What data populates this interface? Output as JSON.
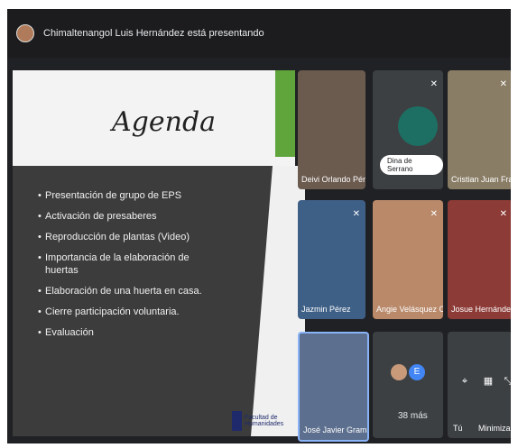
{
  "topbar": {
    "presenter_text": "Chimaltenangol Luis Hernández está presentando"
  },
  "slide": {
    "heading": "Agenda",
    "items": [
      "Presentación de grupo de EPS",
      "Activación de presaberes",
      "Reproducción de plantas (Video)",
      "Importancia de la elaboración de huertas",
      "Elaboración de una huerta en casa.",
      "Cierre participación voluntaria.",
      "Evaluación"
    ],
    "logo_text": "Facultad de Humanidades"
  },
  "participants": [
    {
      "name": "Deivi Orlando Pérez ..."
    },
    {
      "name": "Dina de Serrano"
    },
    {
      "name": "Cristian Juan Franci..."
    },
    {
      "name": "Jazmin Pérez"
    },
    {
      "name": "Angie Velásquez Co..."
    },
    {
      "name": "Josue Hernández"
    },
    {
      "name": "José Javier Gramajo ..."
    }
  ],
  "more": {
    "initial": "E",
    "count": "38 más"
  },
  "self_tile": {
    "label": "Tú",
    "minimize": "Minimizar"
  },
  "colors": {
    "background": "#202124",
    "accent_green": "#5fa53b",
    "tile": "#3c4043"
  }
}
